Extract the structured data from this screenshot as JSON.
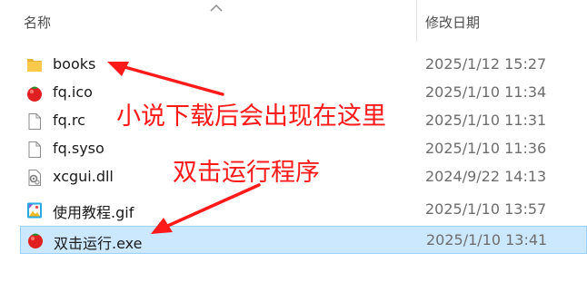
{
  "header": {
    "name_label": "名称",
    "date_label": "修改日期"
  },
  "files": [
    {
      "name": "books",
      "date": "2025/1/12 15:27",
      "icon": "folder-icon"
    },
    {
      "name": "fq.ico",
      "date": "2025/1/10 11:34",
      "icon": "tomato-icon"
    },
    {
      "name": "fq.rc",
      "date": "2025/1/10 11:31",
      "icon": "document-icon"
    },
    {
      "name": "fq.syso",
      "date": "2025/1/10 11:36",
      "icon": "document-icon"
    },
    {
      "name": "xcgui.dll",
      "date": "2024/9/22 14:13",
      "icon": "dll-gear-icon"
    },
    {
      "name": "使用教程.gif",
      "date": "2025/1/10 13:57",
      "icon": "image-icon"
    },
    {
      "name": "双击运行.exe",
      "date": "2025/1/10 13:41",
      "icon": "tomato-icon",
      "selected": true
    }
  ],
  "annotations": {
    "books_note": "小说下载后会出现在这里",
    "run_note": "双击运行程序",
    "arrow_color": "#ff1a1a"
  },
  "colors": {
    "selection_bg": "#cce8ff",
    "selection_border": "#99d1ff",
    "folder": "#f8c94a",
    "tomato": "#e02020"
  }
}
